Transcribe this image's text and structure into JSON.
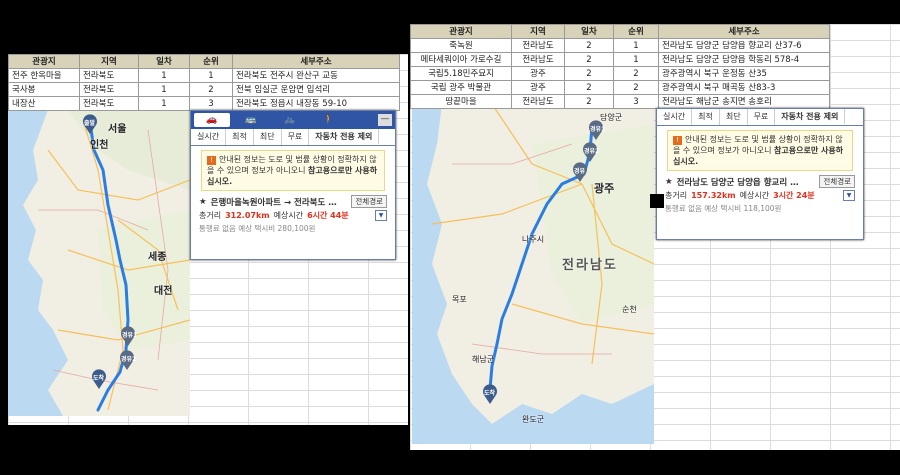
{
  "left": {
    "table": {
      "headers": [
        "관광지",
        "지역",
        "일차",
        "순위",
        "세부주소"
      ],
      "rows": [
        [
          "전주 한옥마을",
          "전라북도",
          "1",
          "1",
          "전라북도 전주시 완산구 교동"
        ],
        [
          "국사봉",
          "전라북도",
          "1",
          "2",
          "전북 임실군 운암면 입석리"
        ],
        [
          "내장산",
          "전라북도",
          "1",
          "3",
          "전라북도 정읍시 내장동 59-10"
        ]
      ]
    },
    "map_labels": {
      "start": "출발",
      "seoul": "서울",
      "incheon": "인천",
      "sejong": "세종",
      "daejeon": "대전",
      "waypoint1": "경유1",
      "waypoint2": "경유2",
      "end": "도착"
    },
    "panel": {
      "modes": [
        "🚗",
        "🚌",
        "🚲",
        "🚶"
      ],
      "close": "—",
      "tabs": [
        "실시간",
        "최적",
        "최단",
        "무료",
        "자동차 전용 제외"
      ],
      "notice_text_1": "안내된 정보는 도로 및 법률 상황이 정확하지 않",
      "notice_text_2": "을 수 있으며 정보가 아니오니 ",
      "notice_bold": "참고용으로만 사용하십시오.",
      "route": "은행마을녹원아파트 → 전라북도 …",
      "full_route": "전체경로",
      "summary_label1": "총거리",
      "distance": "312.07km",
      "summary_label2": "예상시간",
      "time": "6시간 44분",
      "sub": "통행료 없음 예상 택시비 280,100원"
    }
  },
  "right": {
    "table": {
      "headers": [
        "관광지",
        "지역",
        "일차",
        "순위",
        "세부주소"
      ],
      "rows": [
        [
          "죽녹원",
          "전라남도",
          "2",
          "1",
          "전라남도 담양군 담양읍 향교리 산37-6"
        ],
        [
          "메타세쿼이아 가로수길",
          "전라남도",
          "2",
          "1",
          "전라남도 담양군 담양읍 학동리 578-4"
        ],
        [
          "국립5.18민주묘지",
          "광주",
          "2",
          "2",
          "광주광역시 북구 운정동 산35"
        ],
        [
          "국립 광주 박물관",
          "광주",
          "2",
          "2",
          "광주광역시 북구 매곡동 산83-3"
        ],
        [
          "땅끝마을",
          "전라남도",
          "2",
          "3",
          "전라남도 해남군 송지면 송호리"
        ]
      ]
    },
    "map_labels": {
      "gwangju": "광주",
      "jeonnam": "전라남도",
      "waypoint1": "경유1",
      "waypoint2": "경유2",
      "waypoint3": "경유",
      "end": "도착",
      "damyang": "담양군",
      "naju": "나주시",
      "suncheon": "순천",
      "mokpo": "목포",
      "haenam": "해남군",
      "wando": "완도군"
    },
    "panel": {
      "tabs": [
        "실시간",
        "최적",
        "최단",
        "무료",
        "자동차 전용 제외"
      ],
      "notice_text_1": "안내된 정보는 도로 및 법률 상황이 정확하지 않",
      "notice_text_2": "을 수 있으며 정보가 아니오니 ",
      "notice_bold": "참고용으로만 사용하십시오.",
      "route": "전라남도 담양군 담양읍 향교리 …",
      "full_route": "전체경로",
      "summary_label1": "총거리",
      "distance": "157.32km",
      "summary_label2": "예상시간",
      "time": "3시간 24분",
      "sub": "통행료 없음 예상 택시비 118,100원"
    }
  },
  "colors": {
    "route": "#2a7de1",
    "pin": "#3c5d8c",
    "header_bg": "#d8d2b8",
    "mode_bar": "#2f55a4",
    "accent_red": "#e0301e"
  }
}
